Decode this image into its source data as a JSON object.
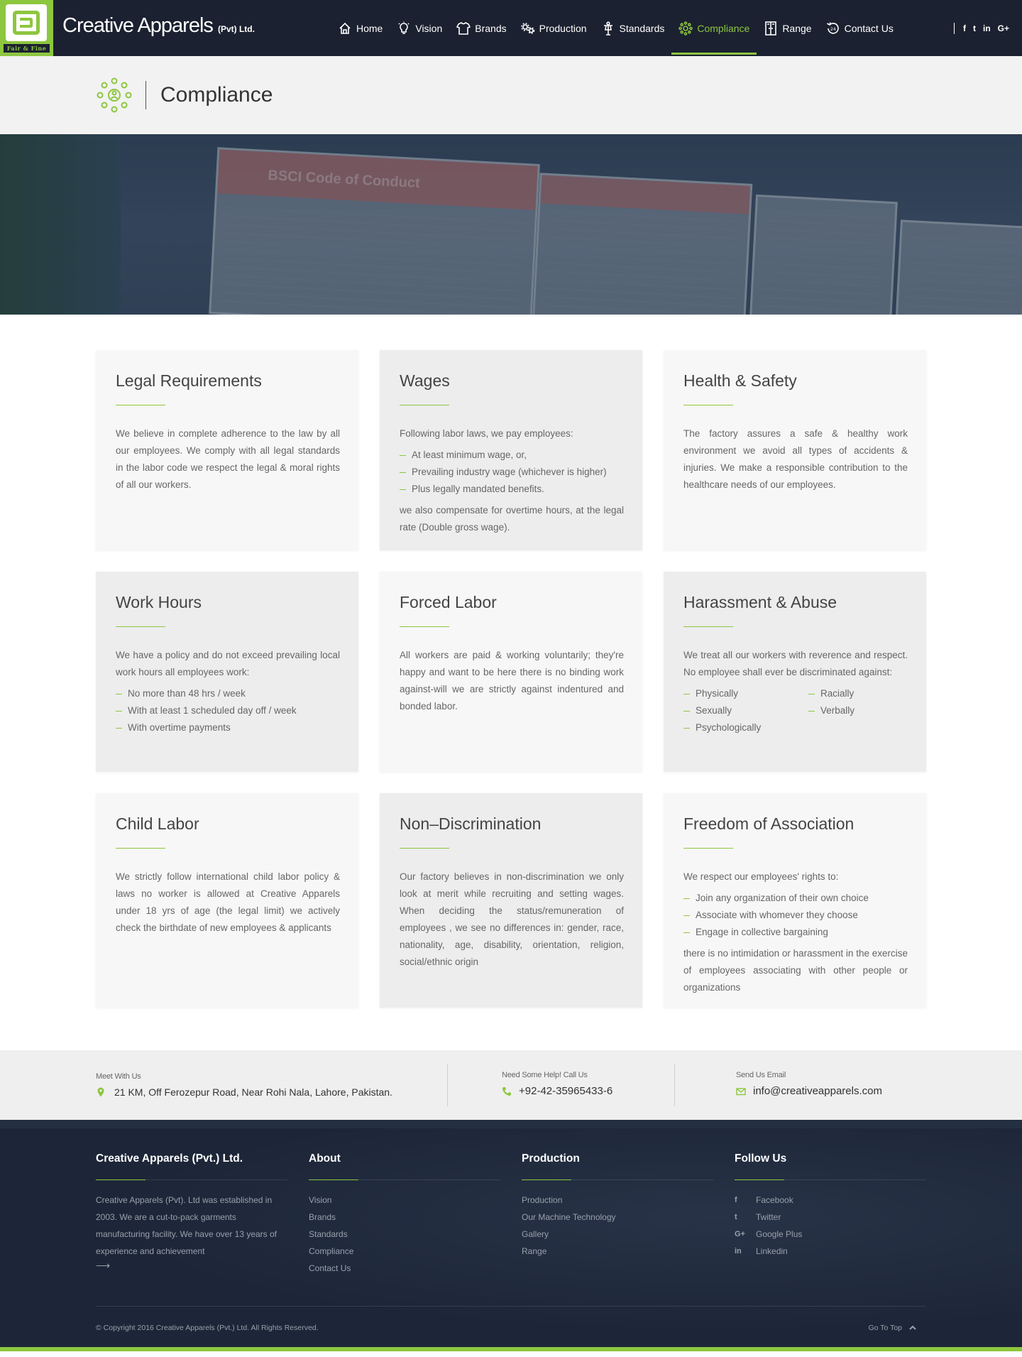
{
  "header": {
    "logo_tagline": "Fair & Fine",
    "brand_name": "Creative Apparels",
    "brand_suffix": "(Pvt) Ltd.",
    "nav": [
      {
        "label": "Home",
        "icon": "home-icon"
      },
      {
        "label": "Vision",
        "icon": "lightbulb-icon"
      },
      {
        "label": "Brands",
        "icon": "shirt-icon"
      },
      {
        "label": "Production",
        "icon": "gears-icon"
      },
      {
        "label": "Standards",
        "icon": "mannequin-icon"
      },
      {
        "label": "Compliance",
        "icon": "compliance-icon",
        "active": true
      },
      {
        "label": "Range",
        "icon": "wardrobe-icon"
      },
      {
        "label": "Contact Us",
        "icon": "support-24-icon"
      }
    ],
    "social": [
      "f",
      "t",
      "in",
      "G+"
    ]
  },
  "page": {
    "title": "Compliance"
  },
  "hero": {
    "board_text": "BSCI Code of Conduct"
  },
  "cards": {
    "legal": {
      "title": "Legal Requirements",
      "body": "We believe in complete adherence to the law by all our employees. We comply with all legal standards in the labor code we respect the legal & moral rights of all our workers."
    },
    "wages": {
      "title": "Wages",
      "intro": "Following labor laws, we pay employees:",
      "items": [
        "At least minimum wage, or,",
        "Prevailing industry wage (whichever is higher)",
        "Plus legally mandated benefits."
      ],
      "outro": "we also compensate for overtime hours, at the legal rate (Double gross wage)."
    },
    "health": {
      "title": "Health & Safety",
      "body": "The factory assures a safe & healthy work environment we avoid all types of accidents & injuries. We make a responsible contribution to the healthcare needs of our employees."
    },
    "hours": {
      "title": "Work Hours",
      "intro": "We have a policy and do not exceed prevailing local work hours all employees work:",
      "items": [
        "No more than 48 hrs / week",
        "With at least 1 scheduled day off / week",
        "With overtime payments"
      ]
    },
    "forced": {
      "title": "Forced Labor",
      "body": "All workers are paid & working voluntarily; they're happy and want to be here there is no binding work against-will we are strictly against indentured and bonded labor."
    },
    "harassment": {
      "title": "Harassment & Abuse",
      "intro": "We treat all our workers with reverence and respect. No employee shall ever be discriminated against:",
      "items": [
        "Physically",
        "Racially",
        "Sexually",
        "Verbally",
        "Psychologically"
      ]
    },
    "child": {
      "title": "Child Labor",
      "body": "We strictly follow international child labor policy & laws no worker is allowed at Creative Apparels under 18 yrs of age (the legal limit) we actively check the birthdate of new employees & applicants"
    },
    "nondisc": {
      "title": "Non–Discrimination",
      "body": "Our factory believes in non-discrimination we only look at merit while recruiting and setting wages. When deciding the status/remuneration of employees , we see no differences in: gender, race, nationality, age, disability, orientation, religion, social/ethnic origin"
    },
    "association": {
      "title": "Freedom of Association",
      "intro": "We respect our employees' rights to:",
      "items": [
        "Join any organization of their own choice",
        "Associate with whomever they choose",
        "Engage in collective bargaining"
      ],
      "outro": "there is no intimidation or harassment in the exercise of employees associating with other people or organizations"
    }
  },
  "contact": {
    "address_label": "Meet With Us",
    "address": "21 KM, Off Ferozepur Road, Near Rohi Nala, Lahore, Pakistan.",
    "phone_label": "Need Some Help! Call Us",
    "phone": "+92-42-35965433-6",
    "email_label": "Send Us Email",
    "email": "info@creativeapparels.com"
  },
  "footer": {
    "company_heading": "Creative Apparels (Pvt.) Ltd.",
    "company_text": "Creative Apparels (Pvt). Ltd was established in 2003. We are a cut-to-pack garments manufacturing facility. We have over 13 years of experience and achievement",
    "about_heading": "About",
    "about_links": [
      "Vision",
      "Brands",
      "Standards",
      "Compliance",
      "Contact Us"
    ],
    "production_heading": "Production",
    "production_links": [
      "Production",
      "Our Machine Technology",
      "Gallery",
      "Range"
    ],
    "follow_heading": "Follow Us",
    "follow_links": [
      {
        "icon": "f",
        "label": "Facebook"
      },
      {
        "icon": "t",
        "label": "Twitter"
      },
      {
        "icon": "G+",
        "label": "Google Plus"
      },
      {
        "icon": "in",
        "label": "Linkedin"
      }
    ],
    "copyright": "© Copyright 2016 Creative Apparels (Pvt.) Ltd. All Rights Reserved.",
    "go_top": "Go To Top"
  },
  "colors": {
    "accent": "#8dc63f",
    "header_bg": "#1b2130",
    "footer_bg": "#1d2638"
  }
}
